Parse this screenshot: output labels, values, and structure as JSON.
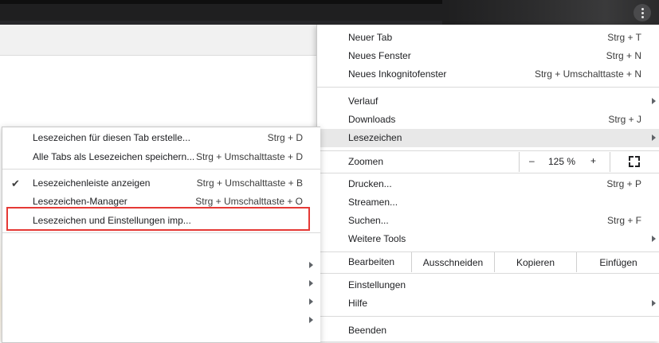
{
  "menu": {
    "items": [
      {
        "label": "Neuer Tab",
        "shortcut": "Strg + T"
      },
      {
        "label": "Neues Fenster",
        "shortcut": "Strg + N"
      },
      {
        "label": "Neues Inkognitofenster",
        "shortcut": "Strg + Umschalttaste + N"
      },
      {
        "label": "Verlauf",
        "shortcut": ""
      },
      {
        "label": "Downloads",
        "shortcut": "Strg + J"
      },
      {
        "label": "Lesezeichen",
        "shortcut": ""
      },
      {
        "label": "Zoomen",
        "shortcut": ""
      },
      {
        "label": "Drucken...",
        "shortcut": "Strg + P"
      },
      {
        "label": "Streamen...",
        "shortcut": ""
      },
      {
        "label": "Suchen...",
        "shortcut": "Strg + F"
      },
      {
        "label": "Weitere Tools",
        "shortcut": ""
      },
      {
        "label": "Einstellungen",
        "shortcut": ""
      },
      {
        "label": "Hilfe",
        "shortcut": ""
      },
      {
        "label": "Beenden",
        "shortcut": ""
      }
    ],
    "zoom": {
      "minus": "–",
      "value": "125 %",
      "plus": "+"
    },
    "edit": {
      "label": "Bearbeiten",
      "cut": "Ausschneiden",
      "copy": "Kopieren",
      "paste": "Einfügen"
    }
  },
  "bookmarks_submenu": {
    "items": [
      {
        "label": "Lesezeichen für diesen Tab erstelle...",
        "shortcut": "Strg + D"
      },
      {
        "label": "Alle Tabs als Lesezeichen speichern...",
        "shortcut": "Strg + Umschalttaste + D"
      },
      {
        "label": "Lesezeichenleiste anzeigen",
        "shortcut": "Strg + Umschalttaste + B"
      },
      {
        "label": "Lesezeichen-Manager",
        "shortcut": "Strg + Umschalttaste + O"
      },
      {
        "label": "Lesezeichen und Einstellungen imp...",
        "shortcut": ""
      }
    ],
    "checkmark": "✔"
  },
  "colors": {
    "highlight": "#e8e8e8",
    "annotation": "#e53935",
    "titlebar": "#1f1f20"
  },
  "icons": [
    "more-vert-icon",
    "fullscreen-icon",
    "checkmark-icon",
    "submenu-arrow-icon"
  ]
}
